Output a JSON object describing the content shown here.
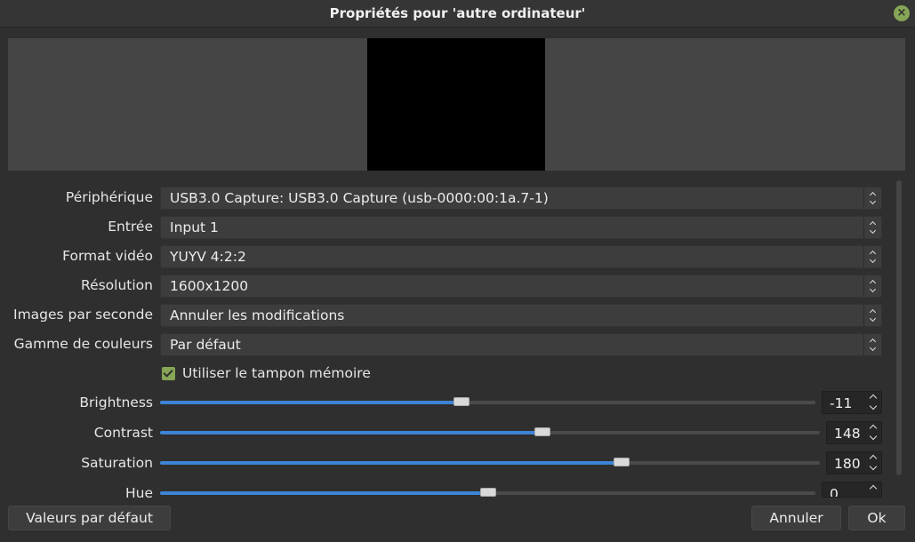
{
  "window": {
    "title": "Propriétés pour 'autre ordinateur'",
    "close_icon": "close-icon",
    "accent_color": "#87a556"
  },
  "properties": {
    "device": {
      "label": "Périphérique",
      "value": "USB3.0 Capture: USB3.0 Capture (usb-0000:00:1a.7-1)"
    },
    "input": {
      "label": "Entrée",
      "value": "Input 1"
    },
    "video_format": {
      "label": "Format vidéo",
      "value": "YUYV 4:2:2"
    },
    "resolution": {
      "label": "Résolution",
      "value": "1600x1200"
    },
    "framerate": {
      "label": "Images par seconde",
      "value": "Annuler les modifications"
    },
    "color_range": {
      "label": "Gamme de couleurs",
      "value": "Par défaut"
    },
    "buffering": {
      "label": "Utiliser le tampon mémoire",
      "checked": true
    }
  },
  "sliders": [
    {
      "label": "Brightness",
      "value": "-11",
      "fill_fraction": 0.46
    },
    {
      "label": "Contrast",
      "value": "148",
      "fill_fraction": 0.58
    },
    {
      "label": "Saturation",
      "value": "180",
      "fill_fraction": 0.7
    },
    {
      "label": "Hue",
      "value": "0",
      "fill_fraction": 0.5
    }
  ],
  "slider_color": "#3d84d6",
  "buttons": {
    "defaults": "Valeurs par défaut",
    "cancel": "Annuler",
    "ok": "Ok"
  }
}
